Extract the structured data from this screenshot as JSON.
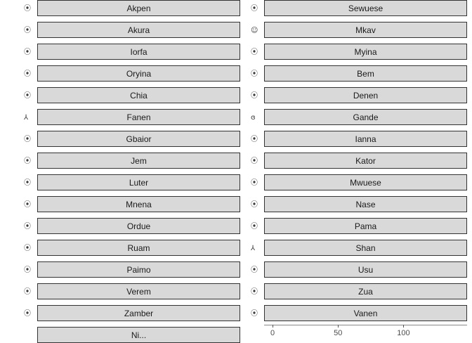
{
  "left_panels": [
    {
      "label": "Akpen",
      "icon": "⦿"
    },
    {
      "label": "Akura",
      "icon": "⦿"
    },
    {
      "label": "Iorfa",
      "icon": "⦿"
    },
    {
      "label": "Oryina",
      "icon": "⦿"
    },
    {
      "label": "Chia",
      "icon": "⦿"
    },
    {
      "label": "Fanen",
      "icon": "⅄"
    },
    {
      "label": "Gbaior",
      "icon": "⦿"
    },
    {
      "label": "Jem",
      "icon": "⦿"
    },
    {
      "label": "Luter",
      "icon": "⦿"
    },
    {
      "label": "Mnena",
      "icon": "⦿"
    },
    {
      "label": "Ordue",
      "icon": "⦿"
    },
    {
      "label": "Ruam",
      "icon": "⦿"
    },
    {
      "label": "Paimo",
      "icon": "⦿"
    },
    {
      "label": "Verem",
      "icon": "⦿"
    },
    {
      "label": "Zamber",
      "icon": "⦿"
    },
    {
      "label": "Ni...",
      "icon": ""
    }
  ],
  "right_panels": [
    {
      "label": "Sewuese",
      "icon": "⦿"
    },
    {
      "label": "Mkav",
      "icon": "☺"
    },
    {
      "label": "Myina",
      "icon": "⦿"
    },
    {
      "label": "Bem",
      "icon": "⦿"
    },
    {
      "label": "Denen",
      "icon": "⦿"
    },
    {
      "label": "Gande",
      "icon": "ɞ"
    },
    {
      "label": "Ianna",
      "icon": "⦿"
    },
    {
      "label": "Kator",
      "icon": "⦿"
    },
    {
      "label": "Mwuese",
      "icon": "⦿"
    },
    {
      "label": "Nase",
      "icon": "⦿"
    },
    {
      "label": "Pama",
      "icon": "⦿"
    },
    {
      "label": "Shan",
      "icon": "⅄"
    },
    {
      "label": "Usu",
      "icon": "⦿"
    },
    {
      "label": "Zua",
      "icon": "⦿"
    },
    {
      "label": "Vanen",
      "icon": "⦿"
    }
  ],
  "axis": {
    "ticks": [
      "0",
      "50",
      "100"
    ],
    "tick_values": [
      0,
      50,
      100
    ],
    "max": 155
  }
}
